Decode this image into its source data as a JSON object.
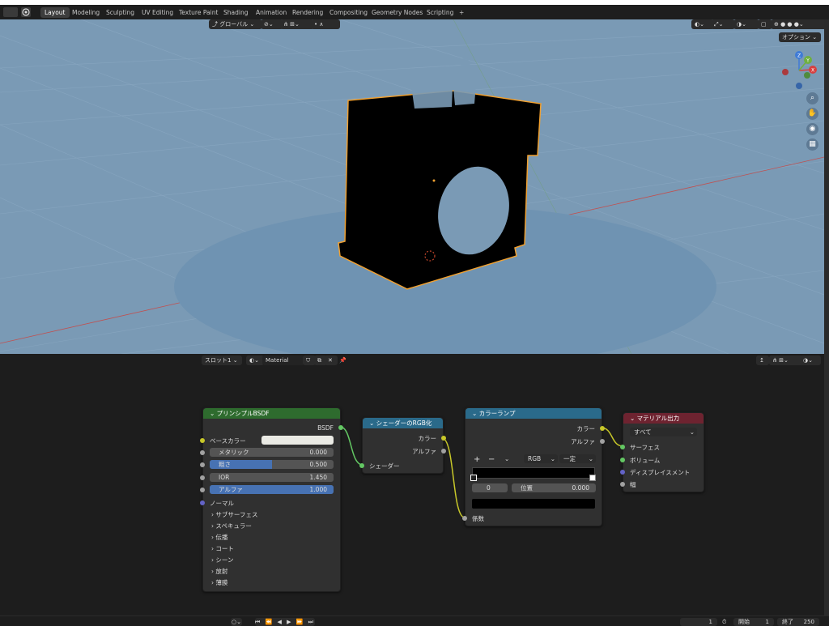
{
  "workspace_tabs": [
    "Layout",
    "Modeling",
    "Sculpting",
    "UV Editing",
    "Texture Paint",
    "Shading",
    "Animation",
    "Rendering",
    "Compositing",
    "Geometry Nodes",
    "Scripting"
  ],
  "active_tab": "Layout",
  "add_tab": "+",
  "viewport": {
    "transform_orientation": "グローバル",
    "options_label": "オプション",
    "gizmo": {
      "x": "X",
      "y": "Y",
      "z": "Z"
    }
  },
  "node_editor": {
    "slot": "スロット1",
    "material": "Material"
  },
  "nodes": {
    "bsdf": {
      "title": "プリンシプルBSDF",
      "output": "BSDF",
      "base_color": "ベースカラー",
      "metallic_label": "メタリック",
      "metallic_value": "0.000",
      "roughness_label": "粗さ",
      "roughness_value": "0.500",
      "roughness_fill": 0.5,
      "ior_label": "IOR",
      "ior_value": "1.450",
      "alpha_label": "アルファ",
      "alpha_value": "1.000",
      "alpha_fill": 1.0,
      "normal": "ノーマル",
      "panels": [
        "サブサーフェス",
        "スペキュラー",
        "伝播",
        "コート",
        "シーン",
        "放射",
        "薄膜"
      ]
    },
    "shader_to_rgb": {
      "title": "シェーダーのRGB化",
      "color_out": "カラー",
      "alpha_out": "アルファ",
      "shader_in": "シェーダー"
    },
    "color_ramp": {
      "title": "カラーランプ",
      "color_out": "カラー",
      "alpha_out": "アルファ",
      "add": "+",
      "remove": "−",
      "mode": "RGB",
      "interpolation": "一定",
      "stop_index": "0",
      "position_label": "位置",
      "position_value": "0.000",
      "factor_in": "係数"
    },
    "material_output": {
      "title": "マテリアル出力",
      "target": "すべて",
      "surface": "サーフェス",
      "volume": "ボリューム",
      "displacement": "ディスプレイスメント",
      "thickness": "幅"
    }
  },
  "timeline": {
    "current_frame": "1",
    "start_label": "開始",
    "start_value": "1",
    "end_label": "終了",
    "end_value": "250"
  },
  "colors": {
    "viewport_bg": "#7a9ab5",
    "node_bg": "#303030",
    "bsdf_header": "#2e6b2e",
    "converter_header": "#2a6a8a",
    "output_header": "#6e2330",
    "accent_blue": "#4772b3",
    "selection_outline": "#f0a030"
  }
}
